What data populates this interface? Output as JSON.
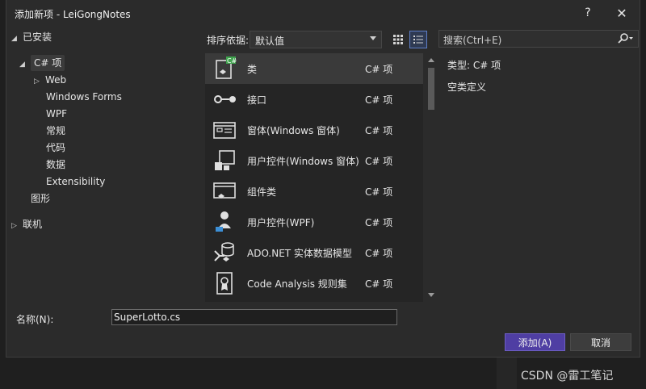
{
  "window": {
    "title": "添加新项 - LeiGongNotes",
    "help": "?",
    "close": "✕"
  },
  "tree": {
    "installed": "已安装",
    "csharp": "C# 项",
    "web": "Web",
    "winforms": "Windows Forms",
    "wpf": "WPF",
    "general": "常规",
    "code": "代码",
    "data": "数据",
    "extensibility": "Extensibility",
    "graphics": "图形",
    "online": "联机"
  },
  "sort": {
    "label": "排序依据:",
    "value": "默认值"
  },
  "search": {
    "placeholder": "搜索(Ctrl+E)"
  },
  "templates": [
    {
      "name": "类",
      "lang": "C# 项",
      "icon": "class-icon"
    },
    {
      "name": "接口",
      "lang": "C# 项",
      "icon": "interface-icon"
    },
    {
      "name": "窗体(Windows 窗体)",
      "lang": "C# 项",
      "icon": "form-icon"
    },
    {
      "name": "用户控件(Windows 窗体)",
      "lang": "C# 项",
      "icon": "user-control-icon"
    },
    {
      "name": "组件类",
      "lang": "C# 项",
      "icon": "component-icon"
    },
    {
      "name": "用户控件(WPF)",
      "lang": "C# 项",
      "icon": "wpf-user-control-icon"
    },
    {
      "name": "ADO.NET 实体数据模型",
      "lang": "C# 项",
      "icon": "entity-model-icon"
    },
    {
      "name": "Code Analysis 规则集",
      "lang": "C# 项",
      "icon": "ruleset-icon"
    }
  ],
  "details": {
    "type_label": "类型:",
    "type_value": "C# 项",
    "description": "空类定义"
  },
  "name_field": {
    "label": "名称(N):",
    "value": "SuperLotto.cs"
  },
  "buttons": {
    "add": "添加(A)",
    "cancel": "取消"
  },
  "watermark": "CSDN @雷工笔记"
}
